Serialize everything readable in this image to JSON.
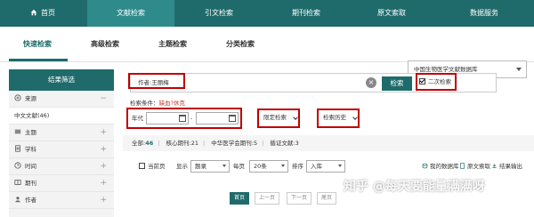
{
  "topnav": {
    "items": [
      {
        "label": "首页",
        "icon": "home-icon"
      },
      {
        "label": "文献检索"
      },
      {
        "label": "引文检索"
      },
      {
        "label": "期刊检索"
      },
      {
        "label": "原文索取"
      },
      {
        "label": "数据服务"
      }
    ],
    "active_index": 1,
    "color": "#1f6b6b"
  },
  "subtabs": {
    "items": [
      "快速检索",
      "高级检索",
      "主题检索",
      "分类检索"
    ],
    "active_index": 0
  },
  "database_select": {
    "value": "中国生物医学文献数据库"
  },
  "left_panel": {
    "title": "结果筛选",
    "facets": [
      {
        "label": "来源",
        "icon": "source-icon",
        "expanded": true,
        "children": [
          "中文文献(46)"
        ]
      },
      {
        "label": "主题",
        "icon": "topic-icon"
      },
      {
        "label": "学科",
        "icon": "subject-icon"
      },
      {
        "label": "时间",
        "icon": "clock-icon"
      },
      {
        "label": "期刊",
        "icon": "journal-icon"
      },
      {
        "label": "作者",
        "icon": "author-icon"
      }
    ]
  },
  "search": {
    "query": "作者:王丽梅",
    "button_label": "检索",
    "second_search_label": "二次检索",
    "second_search_checked": true
  },
  "conditions": {
    "label": "检索条件：",
    "value": "缺血?休克"
  },
  "filters": {
    "year_label": "年代",
    "date_from": "",
    "date_to": "",
    "date_sep": "-",
    "limit_label": "限定检索",
    "history_label": "检索历史"
  },
  "stats": {
    "all_label": "全部:",
    "all_count": "46",
    "core_label": "核心期刊:",
    "core_count": "21",
    "cma_label": "中华医学会期刊:",
    "cma_count": "5",
    "cite_label": "循证文献:",
    "cite_count": "3"
  },
  "toolbar": {
    "current_page_label": "当前页",
    "show_label": "显示",
    "show_value": "题录",
    "per_page_label": "每页",
    "per_page_value": "20条",
    "sort_label": "排序",
    "sort_value": "入库",
    "my_db_label": "我的数据库",
    "order_label": "原文索取",
    "export_label": "结果输出"
  },
  "pager": {
    "first": "首页",
    "prev": "上一页",
    "next": "下一页",
    "last": "尾页"
  },
  "watermark": "知乎 @每天要能量满满呀"
}
